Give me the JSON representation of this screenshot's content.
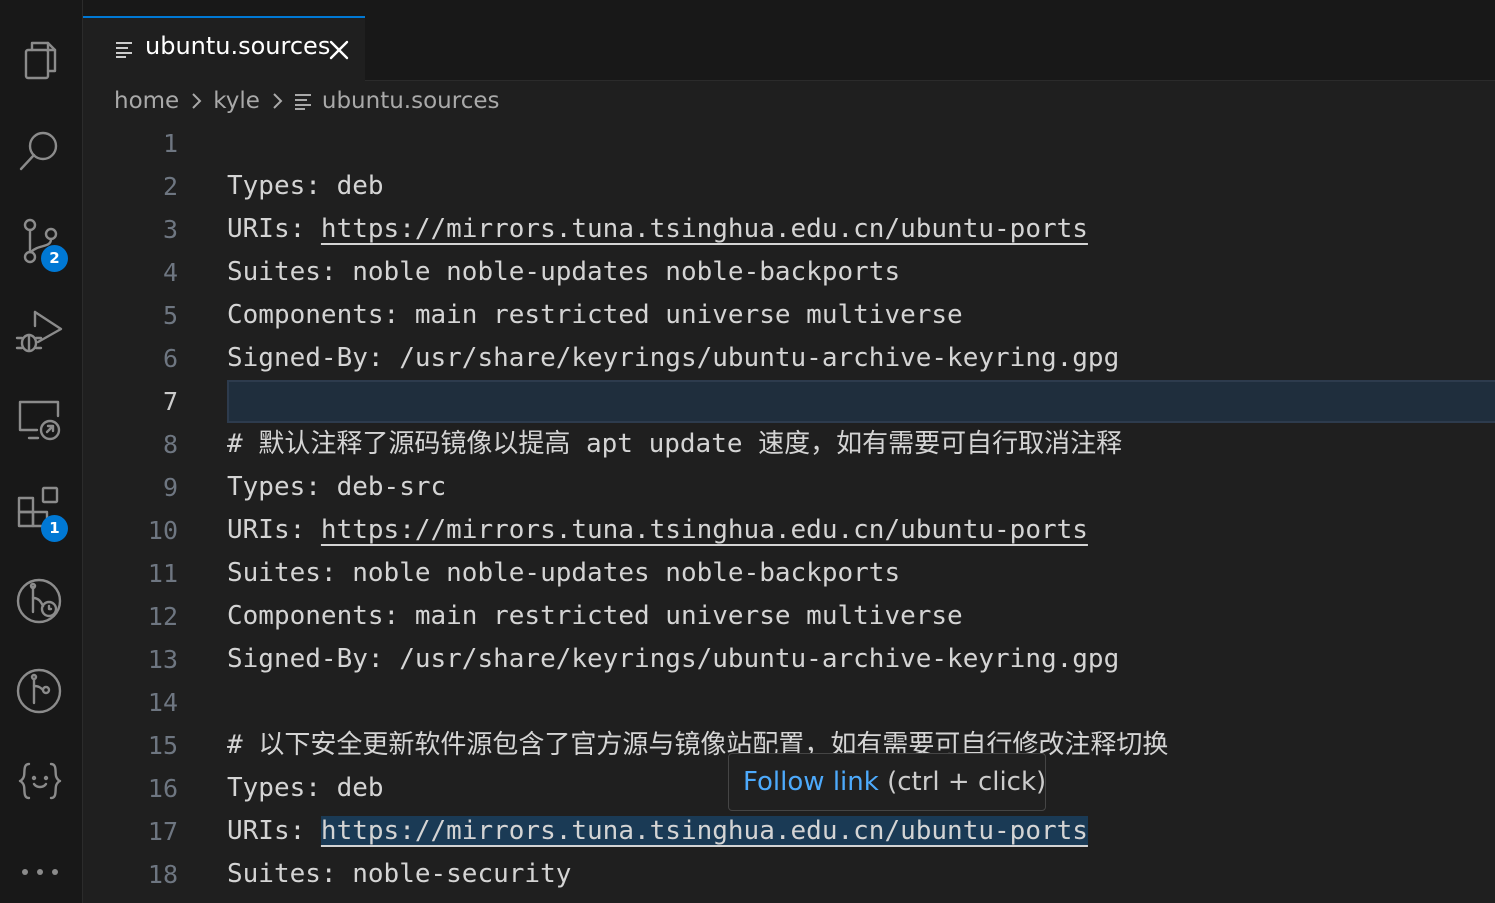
{
  "activity_bar": {
    "items": [
      {
        "name": "explorer-icon"
      },
      {
        "name": "search-icon"
      },
      {
        "name": "source-control-icon",
        "badge": "2"
      },
      {
        "name": "run-debug-icon"
      },
      {
        "name": "remote-explorer-icon"
      },
      {
        "name": "extensions-icon",
        "badge": "1"
      },
      {
        "name": "timeline-icon"
      },
      {
        "name": "git-graph-icon"
      },
      {
        "name": "json-icon"
      },
      {
        "name": "more-icon",
        "label": "..."
      }
    ],
    "badge_color": "#0078d4"
  },
  "tab": {
    "label": "ubuntu.sources",
    "close_icon": "close-icon"
  },
  "breadcrumb": {
    "items": [
      "home",
      "kyle",
      "ubuntu.sources"
    ]
  },
  "editor": {
    "active_line": 7,
    "lines": [
      {
        "n": "1",
        "key": "",
        "value": ""
      },
      {
        "n": "2",
        "key": "Types: ",
        "value": "deb"
      },
      {
        "n": "3",
        "key": "URIs: ",
        "link": "https://mirrors.tuna.tsinghua.edu.cn/ubuntu-ports"
      },
      {
        "n": "4",
        "key": "Suites: ",
        "value": "noble noble-updates noble-backports"
      },
      {
        "n": "5",
        "key": "Components: ",
        "value": "main restricted universe multiverse"
      },
      {
        "n": "6",
        "key": "Signed-By: ",
        "value": "/usr/share/keyrings/ubuntu-archive-keyring.gpg"
      },
      {
        "n": "7",
        "key": "",
        "value": ""
      },
      {
        "n": "8",
        "key": "# ",
        "value": "默认注释了源码镜像以提高 apt update 速度，如有需要可自行取消注释"
      },
      {
        "n": "9",
        "key": "Types: ",
        "value": "deb-src"
      },
      {
        "n": "10",
        "key": "URIs: ",
        "link": "https://mirrors.tuna.tsinghua.edu.cn/ubuntu-ports"
      },
      {
        "n": "11",
        "key": "Suites: ",
        "value": "noble noble-updates noble-backports"
      },
      {
        "n": "12",
        "key": "Components: ",
        "value": "main restricted universe multiverse"
      },
      {
        "n": "13",
        "key": "Signed-By: ",
        "value": "/usr/share/keyrings/ubuntu-archive-keyring.gpg"
      },
      {
        "n": "14",
        "key": "",
        "value": ""
      },
      {
        "n": "15",
        "key": "# ",
        "value": "以下安全更新软件源包含了官方源与镜像站配置，如有需要可自行修改注释切换"
      },
      {
        "n": "16",
        "key": "Types: ",
        "value": "deb"
      },
      {
        "n": "17",
        "key": "URIs: ",
        "link": "https://mirrors.tuna.tsinghua.edu.cn/ubuntu-ports"
      },
      {
        "n": "18",
        "key": "Suites: ",
        "value": "noble-security"
      }
    ]
  },
  "hover": {
    "follow": "Follow link",
    "hint": " (ctrl + click)"
  },
  "colors": {
    "accent": "#0078d4",
    "link_hover": "#4daafc",
    "background": "#1f1f1f"
  }
}
